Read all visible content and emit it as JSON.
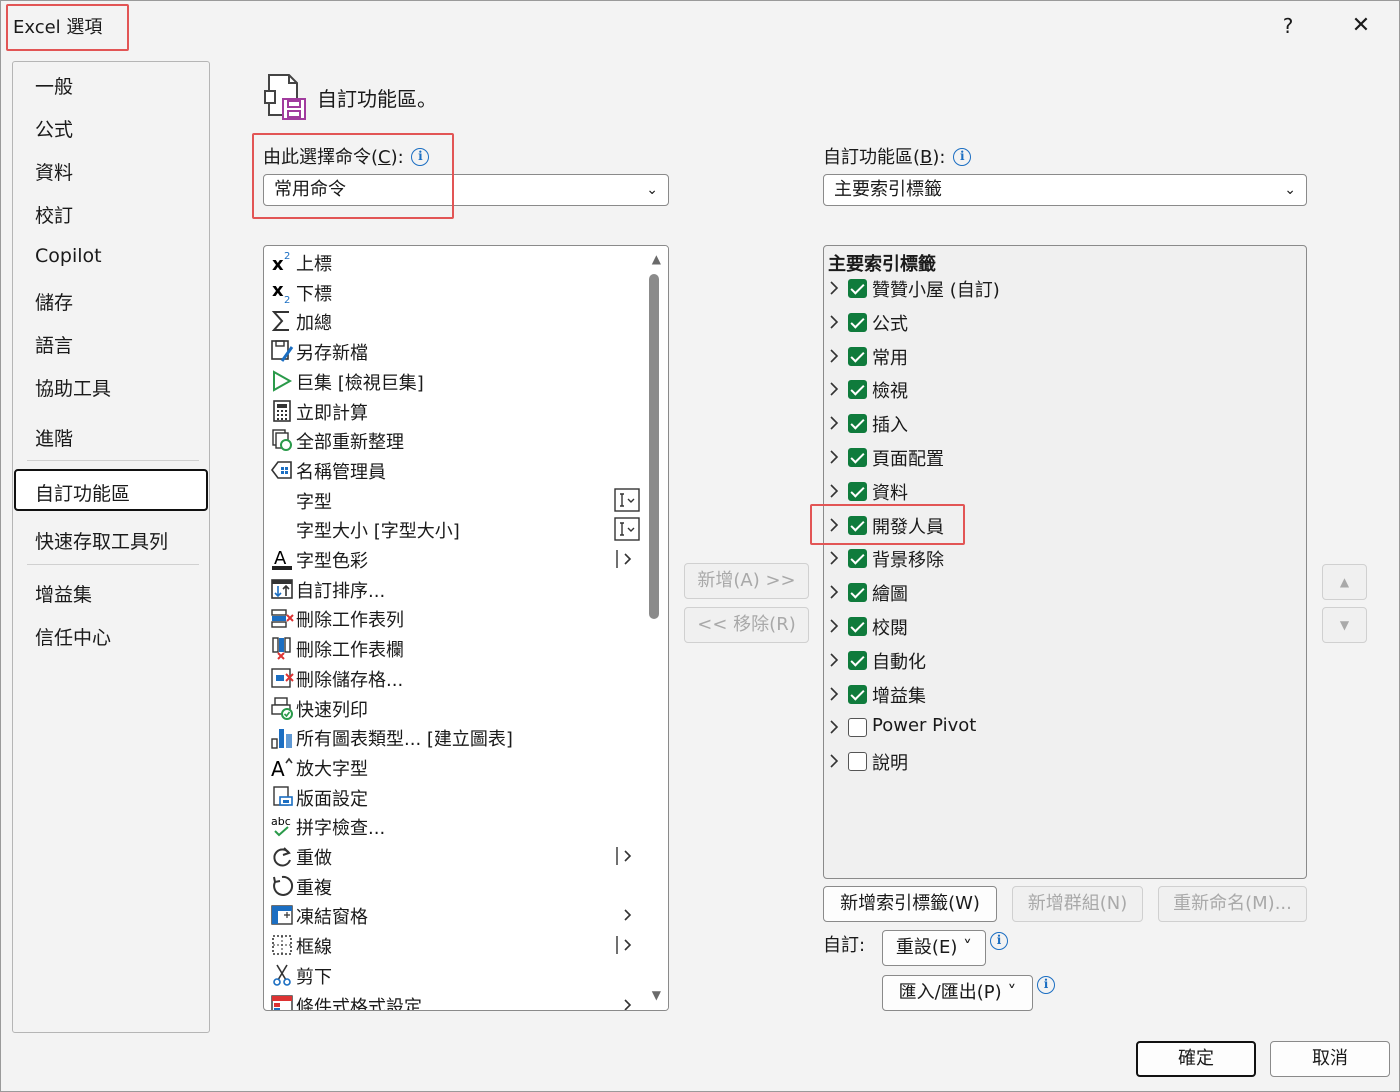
{
  "window": {
    "title": "Excel 選項",
    "help": "?",
    "close": "✕"
  },
  "sidebar": {
    "items": [
      "一般",
      "公式",
      "資料",
      "校訂",
      "Copilot",
      "儲存",
      "語言",
      "協助工具",
      "進階",
      "自訂功能區",
      "快速存取工具列",
      "增益集",
      "信任中心"
    ],
    "selected": "自訂功能區"
  },
  "header": {
    "title": "自訂功能區。"
  },
  "left": {
    "label_pre": "由此選擇命令(",
    "label_key": "C",
    "label_post": "):",
    "dropdown_value": "常用命令",
    "commands": [
      {
        "icon": "superscript-icon",
        "label": "上標"
      },
      {
        "icon": "subscript-icon",
        "label": "下標"
      },
      {
        "icon": "autosum-icon",
        "label": "加總"
      },
      {
        "icon": "save-as-icon",
        "label": "另存新檔"
      },
      {
        "icon": "macro-play-icon",
        "label": "巨集 [檢視巨集]"
      },
      {
        "icon": "calculator-icon",
        "label": "立即計算"
      },
      {
        "icon": "refresh-all-icon",
        "label": "全部重新整理"
      },
      {
        "icon": "name-manager-icon",
        "label": "名稱管理員"
      },
      {
        "icon": "",
        "label": "字型"
      },
      {
        "icon": "",
        "label": "字型大小 [字型大小]"
      },
      {
        "icon": "font-color-icon",
        "label": "字型色彩"
      },
      {
        "icon": "custom-sort-icon",
        "label": "自訂排序..."
      },
      {
        "icon": "delete-row-icon",
        "label": "刪除工作表列"
      },
      {
        "icon": "delete-column-icon",
        "label": "刪除工作表欄"
      },
      {
        "icon": "delete-cells-icon",
        "label": "刪除儲存格..."
      },
      {
        "icon": "quick-print-icon",
        "label": "快速列印"
      },
      {
        "icon": "chart-icon",
        "label": "所有圖表類型... [建立圖表]"
      },
      {
        "icon": "grow-font-icon",
        "label": "放大字型"
      },
      {
        "icon": "page-setup-icon",
        "label": "版面設定"
      },
      {
        "icon": "spelling-icon",
        "label": "拼字檢查..."
      },
      {
        "icon": "redo-icon",
        "label": "重做"
      },
      {
        "icon": "repeat-icon",
        "label": "重複"
      },
      {
        "icon": "freeze-panes-icon",
        "label": "凍結窗格"
      },
      {
        "icon": "borders-icon",
        "label": "框線"
      },
      {
        "icon": "cut-icon",
        "label": "剪下"
      },
      {
        "icon": "conditional-format-icon",
        "label": "條件式格式設定"
      }
    ]
  },
  "middle": {
    "add_label": "新增(A) >>",
    "remove_label": "<< 移除(R)"
  },
  "right": {
    "label_pre": "自訂功能區(",
    "label_key": "B",
    "label_post": "):",
    "dropdown_value": "主要索引標籤",
    "tree_root": "主要索引標籤",
    "tabs": [
      {
        "label": "贊贊小屋 (自訂)",
        "checked": true
      },
      {
        "label": "公式",
        "checked": true
      },
      {
        "label": "常用",
        "checked": true
      },
      {
        "label": "檢視",
        "checked": true
      },
      {
        "label": "插入",
        "checked": true
      },
      {
        "label": "頁面配置",
        "checked": true
      },
      {
        "label": "資料",
        "checked": true
      },
      {
        "label": "開發人員",
        "checked": true
      },
      {
        "label": "背景移除",
        "checked": true
      },
      {
        "label": "繪圖",
        "checked": true
      },
      {
        "label": "校閱",
        "checked": true
      },
      {
        "label": "自動化",
        "checked": true
      },
      {
        "label": "增益集",
        "checked": true
      },
      {
        "label": "Power Pivot",
        "checked": false
      },
      {
        "label": "說明",
        "checked": false
      }
    ],
    "new_tab": "新增索引標籤(W)",
    "new_group": "新增群組(N)",
    "rename": "重新命名(M)...",
    "customize_label": "自訂:",
    "reset": "重設(E) ˅",
    "import_export": "匯入/匯出(P) ˅"
  },
  "footer": {
    "ok": "確定",
    "cancel": "取消"
  },
  "colors": {
    "check": "#0f7b3c",
    "highlight": "#e25555",
    "info": "#1b6ec2"
  }
}
